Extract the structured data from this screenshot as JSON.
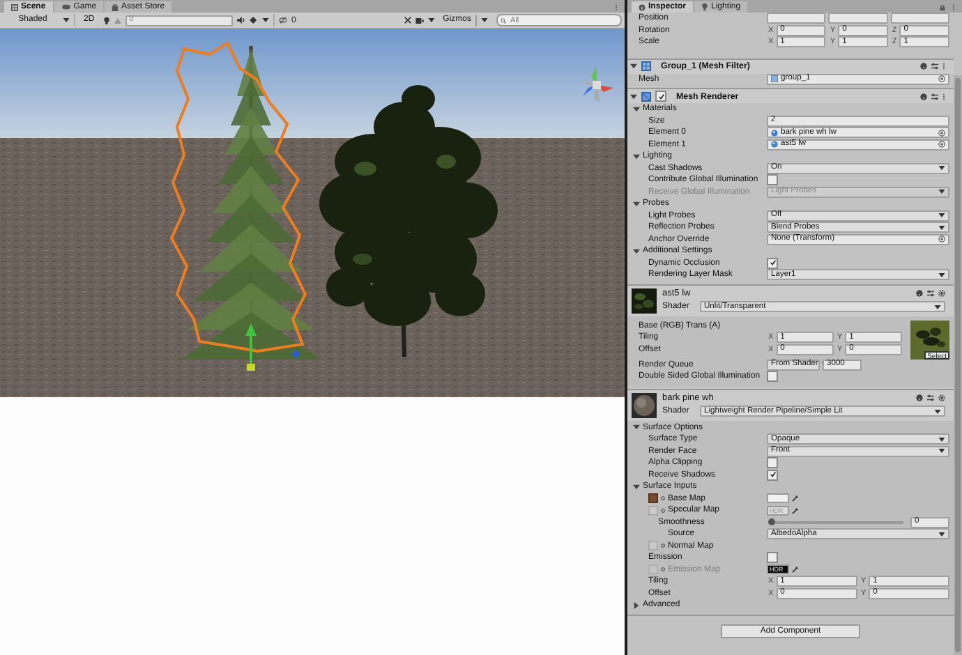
{
  "scene_tabs": [
    {
      "label": "Scene",
      "selected": true
    },
    {
      "label": "Game",
      "selected": false
    },
    {
      "label": "Asset Store",
      "selected": false
    }
  ],
  "scene_toolbar": {
    "shading": "Shaded",
    "toggle_2d": "2D",
    "snap_value": "0",
    "hidden_count": "0",
    "gizmos": "Gizmos",
    "search_placeholder": "All"
  },
  "inspector_tabs": [
    {
      "label": "Inspector",
      "selected": true
    },
    {
      "label": "Lighting",
      "selected": false
    }
  ],
  "transform": [
    {
      "kind": "xyz",
      "label": "Position"
    },
    {
      "kind": "xyz",
      "label": "Rotation",
      "axes": [
        {
          "axis": "X",
          "value": "0"
        },
        {
          "axis": "Y",
          "value": "0"
        },
        {
          "axis": "Z",
          "value": "0"
        }
      ]
    },
    {
      "kind": "xyz",
      "label": "Scale",
      "axes": [
        {
          "axis": "X",
          "value": "1"
        },
        {
          "axis": "Y",
          "value": "1"
        },
        {
          "axis": "Z",
          "value": "1"
        }
      ]
    }
  ],
  "components": [
    {
      "kind": "component",
      "title": "Group_1 (Mesh Filter)",
      "expanded": true,
      "rows": [
        {
          "kind": "mesh_ref",
          "label": "Mesh",
          "value": "group_1"
        }
      ]
    },
    {
      "kind": "component",
      "title": "Mesh Renderer",
      "expanded": true,
      "enabled": true,
      "rows": [
        {
          "kind": "section",
          "label": "Materials",
          "expanded": true,
          "children": [
            {
              "kind": "text",
              "label": "Size",
              "value": "2"
            },
            {
              "kind": "material_ref",
              "label": "Element 0",
              "value": "bark pine wh lw"
            },
            {
              "kind": "material_ref",
              "label": "Element 1",
              "value": "ast5 lw"
            }
          ]
        },
        {
          "kind": "section",
          "label": "Lighting",
          "expanded": true,
          "children": [
            {
              "kind": "dropdown",
              "label": "Cast Shadows",
              "value": "On"
            },
            {
              "kind": "checkbox",
              "label": "Contribute Global Illumination",
              "checked": false
            },
            {
              "kind": "dropdown",
              "label": "Receive Global Illumination",
              "value": "Light Probes",
              "disabled": true
            }
          ]
        },
        {
          "kind": "section",
          "label": "Probes",
          "expanded": true,
          "children": [
            {
              "kind": "dropdown",
              "label": "Light Probes",
              "value": "Off"
            },
            {
              "kind": "dropdown",
              "label": "Reflection Probes",
              "value": "Blend Probes"
            },
            {
              "kind": "object",
              "label": "Anchor Override",
              "value": "None (Transform)"
            }
          ]
        },
        {
          "kind": "section",
          "label": "Additional Settings",
          "expanded": true,
          "children": [
            {
              "kind": "checkbox",
              "label": "Dynamic Occlusion",
              "checked": true
            },
            {
              "kind": "dropdown",
              "label": "Rendering Layer Mask",
              "value": "Layer1"
            }
          ]
        }
      ]
    },
    {
      "kind": "material",
      "name": "ast5 lw",
      "shader_label": "Shader",
      "shader": "Unlit/Transparent",
      "rows": [
        {
          "kind": "texture_block",
          "button": "Select",
          "rows": [
            {
              "kind": "caption",
              "label": "Base (RGB) Trans (A)"
            },
            {
              "kind": "xy",
              "label": "Tiling",
              "axes": [
                {
                  "axis": "X",
                  "value": "1"
                },
                {
                  "axis": "Y",
                  "value": "1"
                }
              ]
            },
            {
              "kind": "xy",
              "label": "Offset",
              "axes": [
                {
                  "axis": "X",
                  "value": "0"
                },
                {
                  "axis": "Y",
                  "value": "0"
                }
              ]
            }
          ]
        },
        {
          "kind": "queue",
          "label": "Render Queue",
          "value": "From Shader",
          "number": "3000"
        },
        {
          "kind": "checkbox",
          "label": "Double Sided Global Illumination",
          "checked": false
        }
      ]
    },
    {
      "kind": "material",
      "name": "bark pine wh",
      "shader_label": "Shader",
      "shader": "Lightweight Render Pipeline/Simple Lit",
      "rows": [
        {
          "kind": "section",
          "label": "Surface Options",
          "expanded": true,
          "children": [
            {
              "kind": "dropdown",
              "label": "Surface Type",
              "value": "Opaque"
            },
            {
              "kind": "dropdown",
              "label": "Render Face",
              "value": "Front"
            },
            {
              "kind": "checkbox",
              "label": "Alpha Clipping",
              "checked": false
            },
            {
              "kind": "checkbox",
              "label": "Receive Shadows",
              "checked": true
            }
          ]
        },
        {
          "kind": "section",
          "label": "Surface Inputs",
          "expanded": true,
          "children": [
            {
              "kind": "map",
              "label": "Base Map",
              "assigned": true,
              "color": "#f2f2f2"
            },
            {
              "kind": "map",
              "label": "Specular Map",
              "assigned": false,
              "hdr": "HDR",
              "children": [
                {
                  "kind": "slider",
                  "label": "Smoothness",
                  "level": 0,
                  "value": "0",
                  "children": [
                    {
                      "kind": "dropdown",
                      "label": "Source",
                      "value": "AlbedoAlpha"
                    }
                  ]
                }
              ]
            },
            {
              "kind": "map",
              "label": "Normal Map",
              "assigned": false
            },
            {
              "kind": "checkbox",
              "label": "Emission",
              "checked": false
            },
            {
              "kind": "map",
              "label": "Emission Map",
              "assigned": false,
              "color": "#0a0a0a",
              "hdr": "HDR",
              "disabled": true
            },
            {
              "kind": "xy",
              "label": "Tiling",
              "axes": [
                {
                  "axis": "X",
                  "value": "1"
                },
                {
                  "axis": "Y",
                  "value": "1"
                }
              ]
            },
            {
              "kind": "xy",
              "label": "Offset",
              "axes": [
                {
                  "axis": "X",
                  "value": "0"
                },
                {
                  "axis": "Y",
                  "value": "0"
                }
              ]
            }
          ]
        },
        {
          "kind": "section",
          "label": "Advanced",
          "expanded": false
        }
      ]
    }
  ],
  "add_component": "Add Component"
}
